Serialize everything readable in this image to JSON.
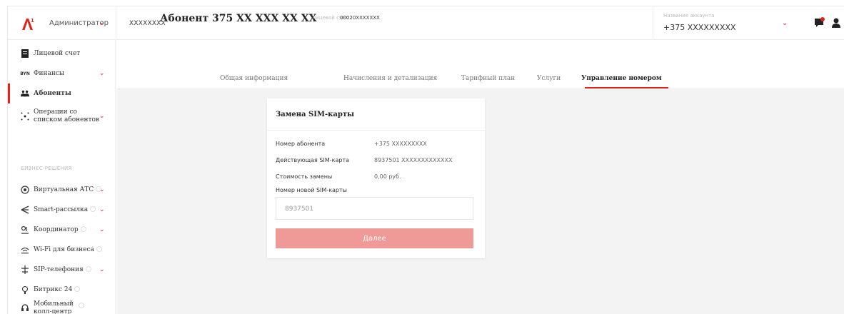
{
  "header": {
    "role": "Администратор",
    "account_short": "XXXXXXXX",
    "account_label": "Название аккаунта",
    "account_value": "+375 XXXXXXXXX"
  },
  "sidebar": {
    "items": [
      {
        "label": "Лицевой счет",
        "icon": "document-icon"
      },
      {
        "label": "Финансы",
        "icon": "byn-icon"
      },
      {
        "label": "Абоненты",
        "icon": "users-icon"
      },
      {
        "label": "Операции со\nсписком абонентов",
        "icon": "operations-icon"
      }
    ],
    "section_title": "БИЗНЕС-РЕШЕНИЯ",
    "solutions": [
      {
        "label": "Виртуальная АТС",
        "icon": "phone-station-icon"
      },
      {
        "label": "Smart-рассылка",
        "icon": "broadcast-icon"
      },
      {
        "label": "Координатор",
        "icon": "coordinator-icon"
      },
      {
        "label": "Wi-Fi для бизнеса",
        "icon": "wifi-icon"
      },
      {
        "label": "SIP-телефония",
        "icon": "sip-icon"
      },
      {
        "label": "Битрикс 24",
        "icon": "bitrix-icon"
      },
      {
        "label": "Мобильный\nколл-центр",
        "icon": "callcenter-icon"
      }
    ]
  },
  "main": {
    "title": "Абонент 375 XX XXX XX XX",
    "personal_account_label": "Лицевой счет",
    "personal_account_value": "00020XXXXXXX",
    "tabs": [
      {
        "label": "Общая информация"
      },
      {
        "label": "Начисления и детализация"
      },
      {
        "label": "Тарифный план"
      },
      {
        "label": "Услуги"
      },
      {
        "label": "Управление номером"
      }
    ]
  },
  "card": {
    "title": "Замена SIM-карты",
    "rows": [
      {
        "label": "Номер абонента",
        "value": "+375 XXXXXXXXX"
      },
      {
        "label": "Действующая SIM-карта",
        "value": "8937501 XXXXXXXXXXXXX"
      },
      {
        "label": "Стоимость замены",
        "value": "0,00 руб."
      }
    ],
    "new_sim_label": "Номер новой SIM-карты",
    "new_sim_value": "8937501",
    "next_button": "Далее"
  },
  "colors": {
    "accent": "#e2231a",
    "button_disabled": "#ef9a96",
    "background": "#f3f3f3"
  }
}
